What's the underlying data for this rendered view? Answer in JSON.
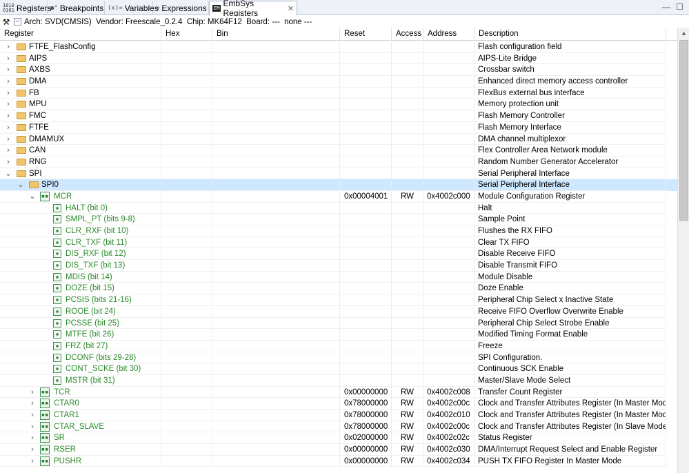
{
  "tabs": [
    {
      "label": "Registers",
      "icon": "binary-icon"
    },
    {
      "label": "Breakpoints",
      "icon": "breakpoints-icon"
    },
    {
      "label": "Variables",
      "icon": "variables-icon"
    },
    {
      "label": "Expressions",
      "icon": "expressions-icon"
    },
    {
      "label": "EmbSys Registers",
      "icon": "embsys-icon"
    }
  ],
  "info": {
    "text": "Arch: SVD(CMSIS)  Vendor: Freescale_0.2.4  Chip: MK64F12  Board: ---  none ---"
  },
  "columns": {
    "register": "Register",
    "hex": "Hex",
    "bin": "Bin",
    "reset": "Reset",
    "access": "Access",
    "address": "Address",
    "description": "Description"
  },
  "rows": [
    {
      "name": "FTFE_FlashConfig",
      "desc": "Flash configuration field",
      "reset": "",
      "access": "",
      "address": ""
    },
    {
      "name": "AIPS",
      "desc": "AIPS-Lite Bridge",
      "reset": "",
      "access": "",
      "address": ""
    },
    {
      "name": "AXBS",
      "desc": "Crossbar switch",
      "reset": "",
      "access": "",
      "address": ""
    },
    {
      "name": "DMA",
      "desc": "Enhanced direct memory access controller",
      "reset": "",
      "access": "",
      "address": ""
    },
    {
      "name": "FB",
      "desc": "FlexBus external bus interface",
      "reset": "",
      "access": "",
      "address": ""
    },
    {
      "name": "MPU",
      "desc": "Memory protection unit",
      "reset": "",
      "access": "",
      "address": ""
    },
    {
      "name": "FMC",
      "desc": "Flash Memory Controller",
      "reset": "",
      "access": "",
      "address": ""
    },
    {
      "name": "FTFE",
      "desc": "Flash Memory Interface",
      "reset": "",
      "access": "",
      "address": ""
    },
    {
      "name": "DMAMUX",
      "desc": "DMA channel multiplexor",
      "reset": "",
      "access": "",
      "address": ""
    },
    {
      "name": "CAN",
      "desc": "Flex Controller Area Network module",
      "reset": "",
      "access": "",
      "address": ""
    },
    {
      "name": "RNG",
      "desc": "Random Number Generator Accelerator",
      "reset": "",
      "access": "",
      "address": ""
    },
    {
      "name": "SPI",
      "desc": "Serial Peripheral Interface",
      "reset": "",
      "access": "",
      "address": ""
    },
    {
      "name": "SPI0",
      "desc": "Serial Peripheral Interface",
      "reset": "",
      "access": "",
      "address": ""
    },
    {
      "name": "MCR",
      "desc": "Module Configuration Register",
      "reset": "0x00004001",
      "access": "RW",
      "address": "0x4002c000"
    },
    {
      "name": "HALT (bit 0)",
      "desc": "Halt",
      "reset": "",
      "access": "",
      "address": ""
    },
    {
      "name": "SMPL_PT (bits 9-8)",
      "desc": "Sample Point",
      "reset": "",
      "access": "",
      "address": ""
    },
    {
      "name": "CLR_RXF (bit 10)",
      "desc": "Flushes the RX FIFO",
      "reset": "",
      "access": "",
      "address": ""
    },
    {
      "name": "CLR_TXF (bit 11)",
      "desc": "Clear TX FIFO",
      "reset": "",
      "access": "",
      "address": ""
    },
    {
      "name": "DIS_RXF (bit 12)",
      "desc": "Disable Receive FIFO",
      "reset": "",
      "access": "",
      "address": ""
    },
    {
      "name": "DIS_TXF (bit 13)",
      "desc": "Disable Transmit FIFO",
      "reset": "",
      "access": "",
      "address": ""
    },
    {
      "name": "MDIS (bit 14)",
      "desc": "Module Disable",
      "reset": "",
      "access": "",
      "address": ""
    },
    {
      "name": "DOZE (bit 15)",
      "desc": "Doze Enable",
      "reset": "",
      "access": "",
      "address": ""
    },
    {
      "name": "PCSIS (bits 21-16)",
      "desc": "Peripheral Chip Select x Inactive State",
      "reset": "",
      "access": "",
      "address": ""
    },
    {
      "name": "ROOE (bit 24)",
      "desc": "Receive FIFO Overflow Overwrite Enable",
      "reset": "",
      "access": "",
      "address": ""
    },
    {
      "name": "PCSSE (bit 25)",
      "desc": "Peripheral Chip Select Strobe Enable",
      "reset": "",
      "access": "",
      "address": ""
    },
    {
      "name": "MTFE (bit 26)",
      "desc": "Modified Timing Format Enable",
      "reset": "",
      "access": "",
      "address": ""
    },
    {
      "name": "FRZ (bit 27)",
      "desc": "Freeze",
      "reset": "",
      "access": "",
      "address": ""
    },
    {
      "name": "DCONF (bits 29-28)",
      "desc": "SPI Configuration.",
      "reset": "",
      "access": "",
      "address": ""
    },
    {
      "name": "CONT_SCKE (bit 30)",
      "desc": "Continuous SCK Enable",
      "reset": "",
      "access": "",
      "address": ""
    },
    {
      "name": "MSTR (bit 31)",
      "desc": "Master/Slave Mode Select",
      "reset": "",
      "access": "",
      "address": ""
    },
    {
      "name": "TCR",
      "desc": "Transfer Count Register",
      "reset": "0x00000000",
      "access": "RW",
      "address": "0x4002c008"
    },
    {
      "name": "CTAR0",
      "desc": "Clock and Transfer Attributes Register (In Master Mode)",
      "reset": "0x78000000",
      "access": "RW",
      "address": "0x4002c00c"
    },
    {
      "name": "CTAR1",
      "desc": "Clock and Transfer Attributes Register (In Master Mode)",
      "reset": "0x78000000",
      "access": "RW",
      "address": "0x4002c010"
    },
    {
      "name": "CTAR_SLAVE",
      "desc": "Clock and Transfer Attributes Register (In Slave Mode)",
      "reset": "0x78000000",
      "access": "RW",
      "address": "0x4002c00c"
    },
    {
      "name": "SR",
      "desc": "Status Register",
      "reset": "0x02000000",
      "access": "RW",
      "address": "0x4002c02c"
    },
    {
      "name": "RSER",
      "desc": "DMA/Interrupt Request Select and Enable Register",
      "reset": "0x00000000",
      "access": "RW",
      "address": "0x4002c030"
    },
    {
      "name": "PUSHR",
      "desc": "PUSH TX FIFO Register In Master Mode",
      "reset": "0x00000000",
      "access": "RW",
      "address": "0x4002c034"
    }
  ]
}
